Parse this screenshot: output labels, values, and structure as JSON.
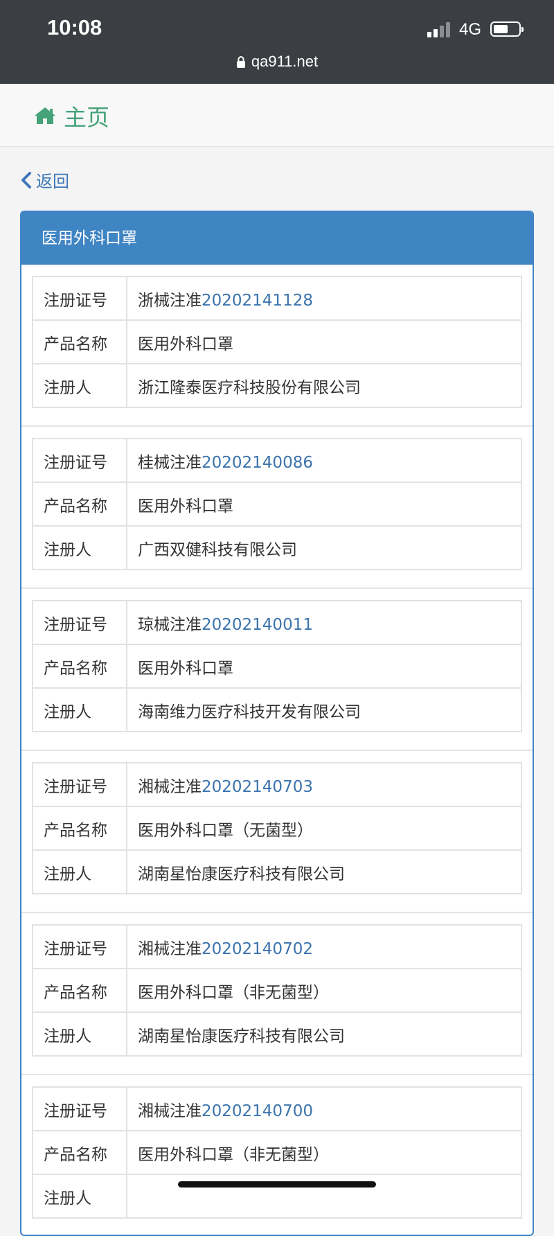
{
  "status_bar": {
    "time": "10:08",
    "network": "4G",
    "url": "qa911.net"
  },
  "nav": {
    "home_label": "主页",
    "back_label": "返回"
  },
  "panel": {
    "title": "医用外科口罩"
  },
  "labels": {
    "reg_no": "注册证号",
    "product": "产品名称",
    "registrant": "注册人"
  },
  "records": [
    {
      "reg_prefix": "浙械注准",
      "reg_number": "20202141128",
      "product": "医用外科口罩",
      "registrant": "浙江隆泰医疗科技股份有限公司"
    },
    {
      "reg_prefix": "桂械注准",
      "reg_number": "20202140086",
      "product": "医用外科口罩",
      "registrant": "广西双健科技有限公司"
    },
    {
      "reg_prefix": "琼械注准",
      "reg_number": "20202140011",
      "product": "医用外科口罩",
      "registrant": "海南维力医疗科技开发有限公司"
    },
    {
      "reg_prefix": "湘械注准",
      "reg_number": "20202140703",
      "product": "医用外科口罩（无菌型）",
      "registrant": "湖南星怡康医疗科技有限公司"
    },
    {
      "reg_prefix": "湘械注准",
      "reg_number": "20202140702",
      "product": "医用外科口罩（非无菌型）",
      "registrant": "湖南星怡康医疗科技有限公司"
    },
    {
      "reg_prefix": "湘械注准",
      "reg_number": "20202140700",
      "product": "医用外科口罩（非无菌型）",
      "registrant": ""
    }
  ]
}
